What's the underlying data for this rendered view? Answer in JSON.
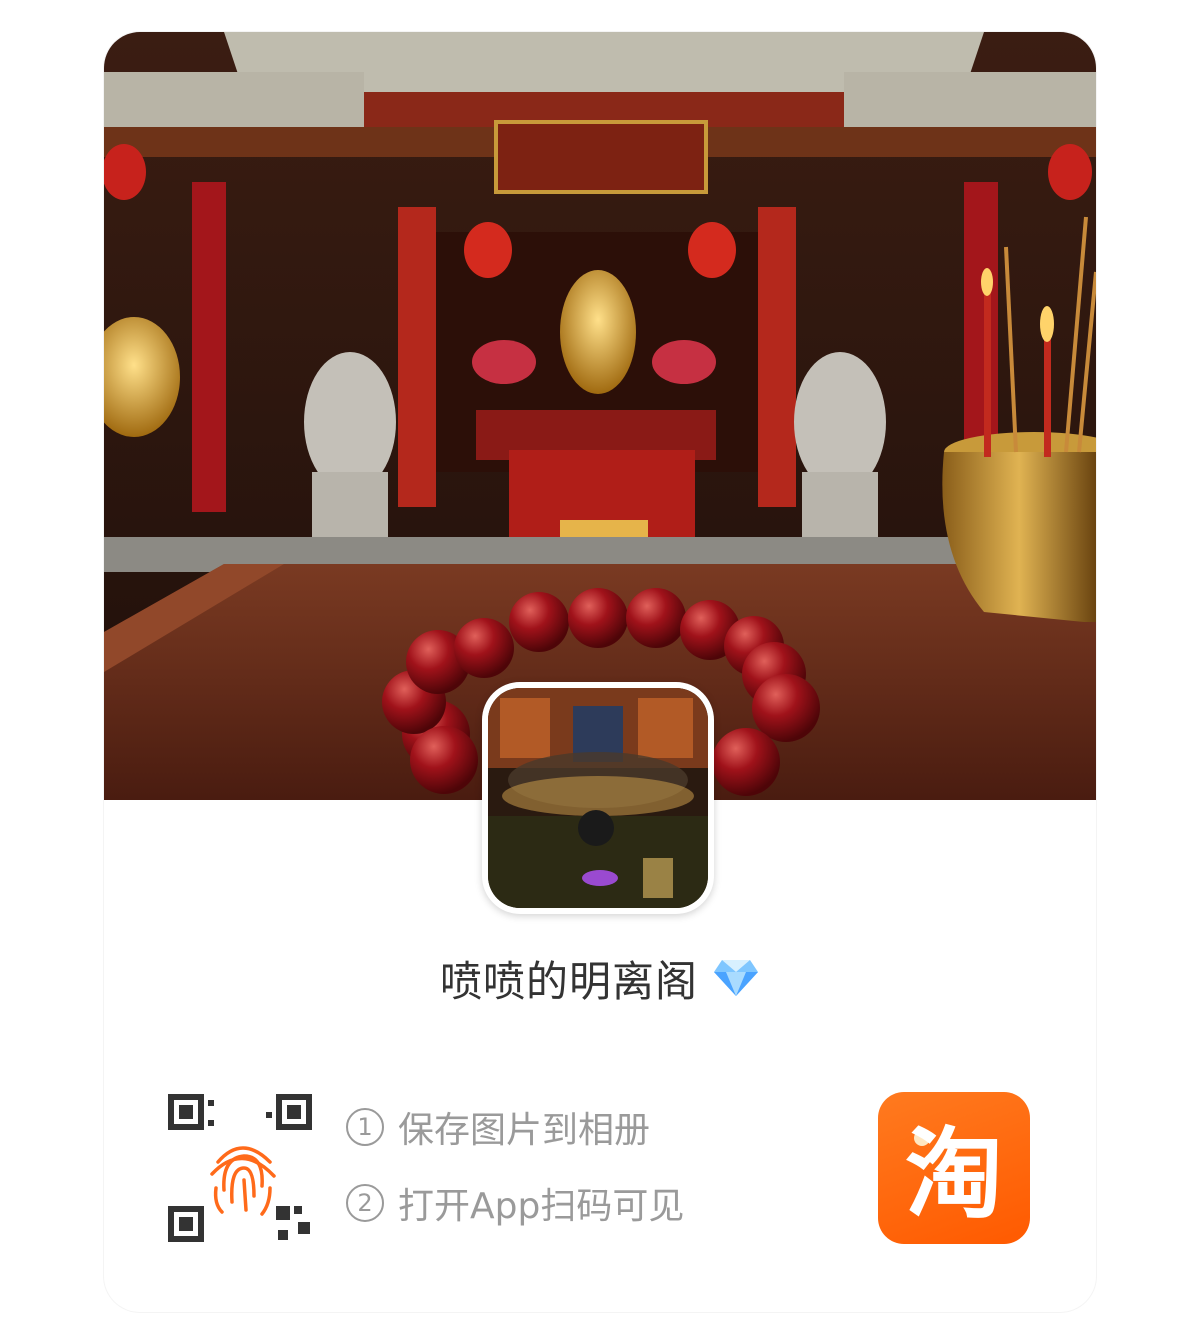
{
  "shop": {
    "name": "喷喷的明离阁",
    "badge_icon": "diamond-icon"
  },
  "instructions": [
    {
      "num": "1",
      "text": "保存图片到相册"
    },
    {
      "num": "2",
      "text": "打开App扫码可见"
    }
  ],
  "app_logo": {
    "char": "淘",
    "color": "#ff5a00"
  },
  "colors": {
    "accent": "#ff5a00",
    "text": "#333333",
    "muted": "#9a9a9a"
  }
}
